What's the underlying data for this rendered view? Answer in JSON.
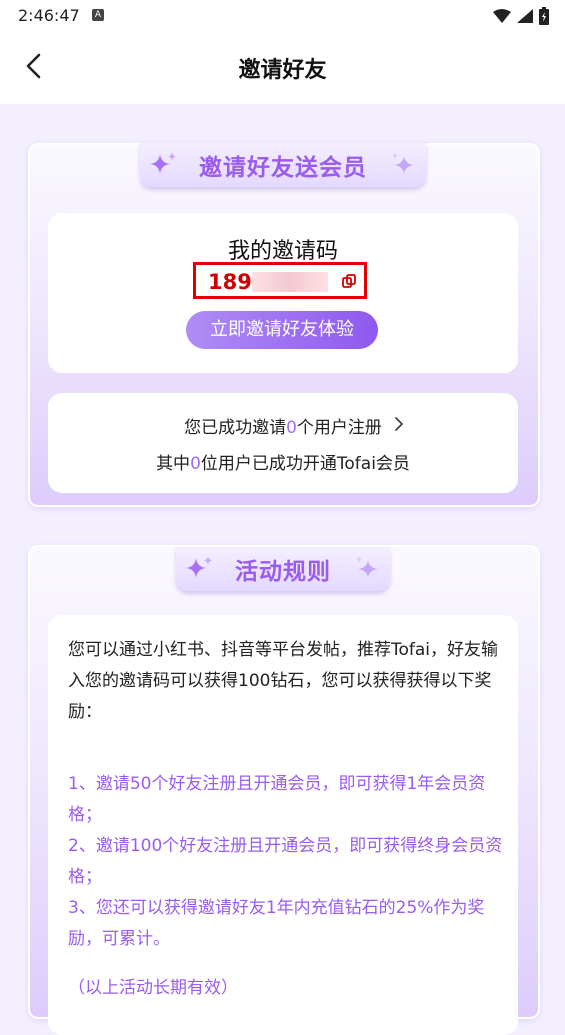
{
  "status": {
    "time": "2:46:47",
    "a_badge": "A"
  },
  "header": {
    "title": "邀请好友"
  },
  "invite_card": {
    "ribbon": "邀请好友送会员",
    "code_label": "我的邀请码",
    "code_visible": "1896",
    "invite_button": "立即邀请好友体验",
    "stats": {
      "line1_prefix": "您已成功邀请",
      "invited_count": "0",
      "line1_suffix": "个用户注册",
      "line2_prefix": "其中",
      "member_count": "0",
      "line2_suffix": "位用户已成功开通Tofai会员"
    }
  },
  "rules_card": {
    "ribbon": "活动规则",
    "intro": "您可以通过小红书、抖音等平台发帖，推荐Tofai，好友输入您的邀请码可以获得100钻石，您可以获得获得以下奖励：",
    "rules": [
      "1、邀请50个好友注册且开通会员，即可获得1年会员资格；",
      "2、邀请100个好友注册且开通会员，即可获得终身会员资格；",
      "3、您还可以获得邀请好友1年内充值钻石的25%作为奖励，可累计。"
    ],
    "note": "（以上活动长期有效）"
  },
  "colors": {
    "accent": "#9a5cf0",
    "code_red": "#d10000",
    "background": "#f3efff"
  }
}
